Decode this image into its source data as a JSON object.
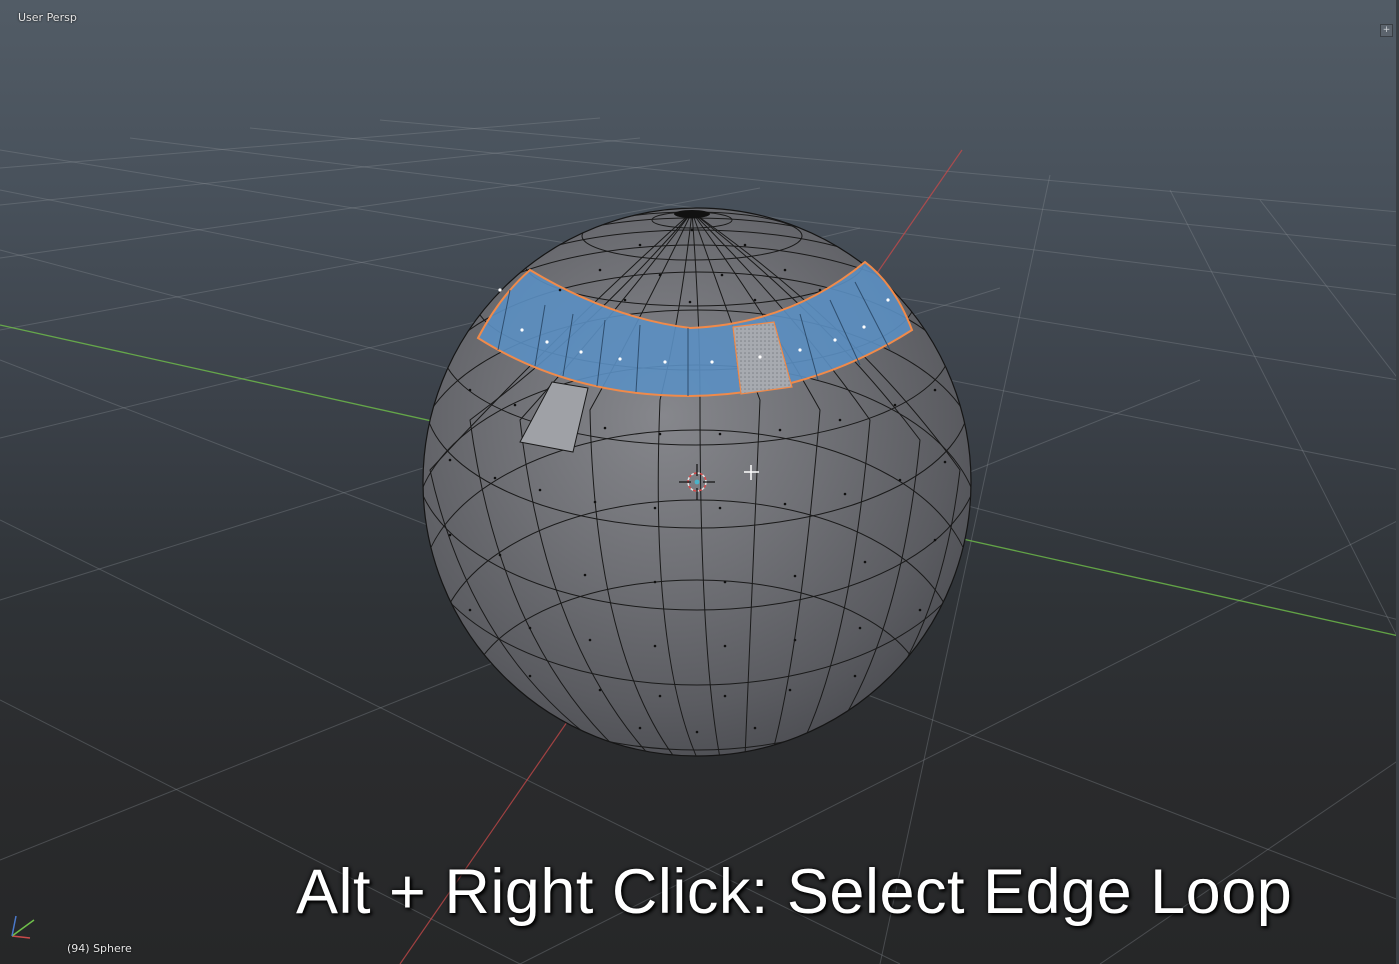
{
  "viewport": {
    "view_label": "User Persp",
    "object_label": "(94) Sphere",
    "corner_button_icon": "plus-icon"
  },
  "caption": "Alt + Right Click: Select Edge Loop",
  "colors": {
    "selection_face": "#5b8fc2",
    "selection_edge": "#f08a4a",
    "axis_x": "#c94a4a",
    "axis_y": "#6fbf4a",
    "mesh_face": "#6e6f73",
    "vertex_dot": "#111111"
  },
  "mesh": {
    "type": "UV sphere",
    "mode": "edit",
    "selection": "edge loop"
  }
}
